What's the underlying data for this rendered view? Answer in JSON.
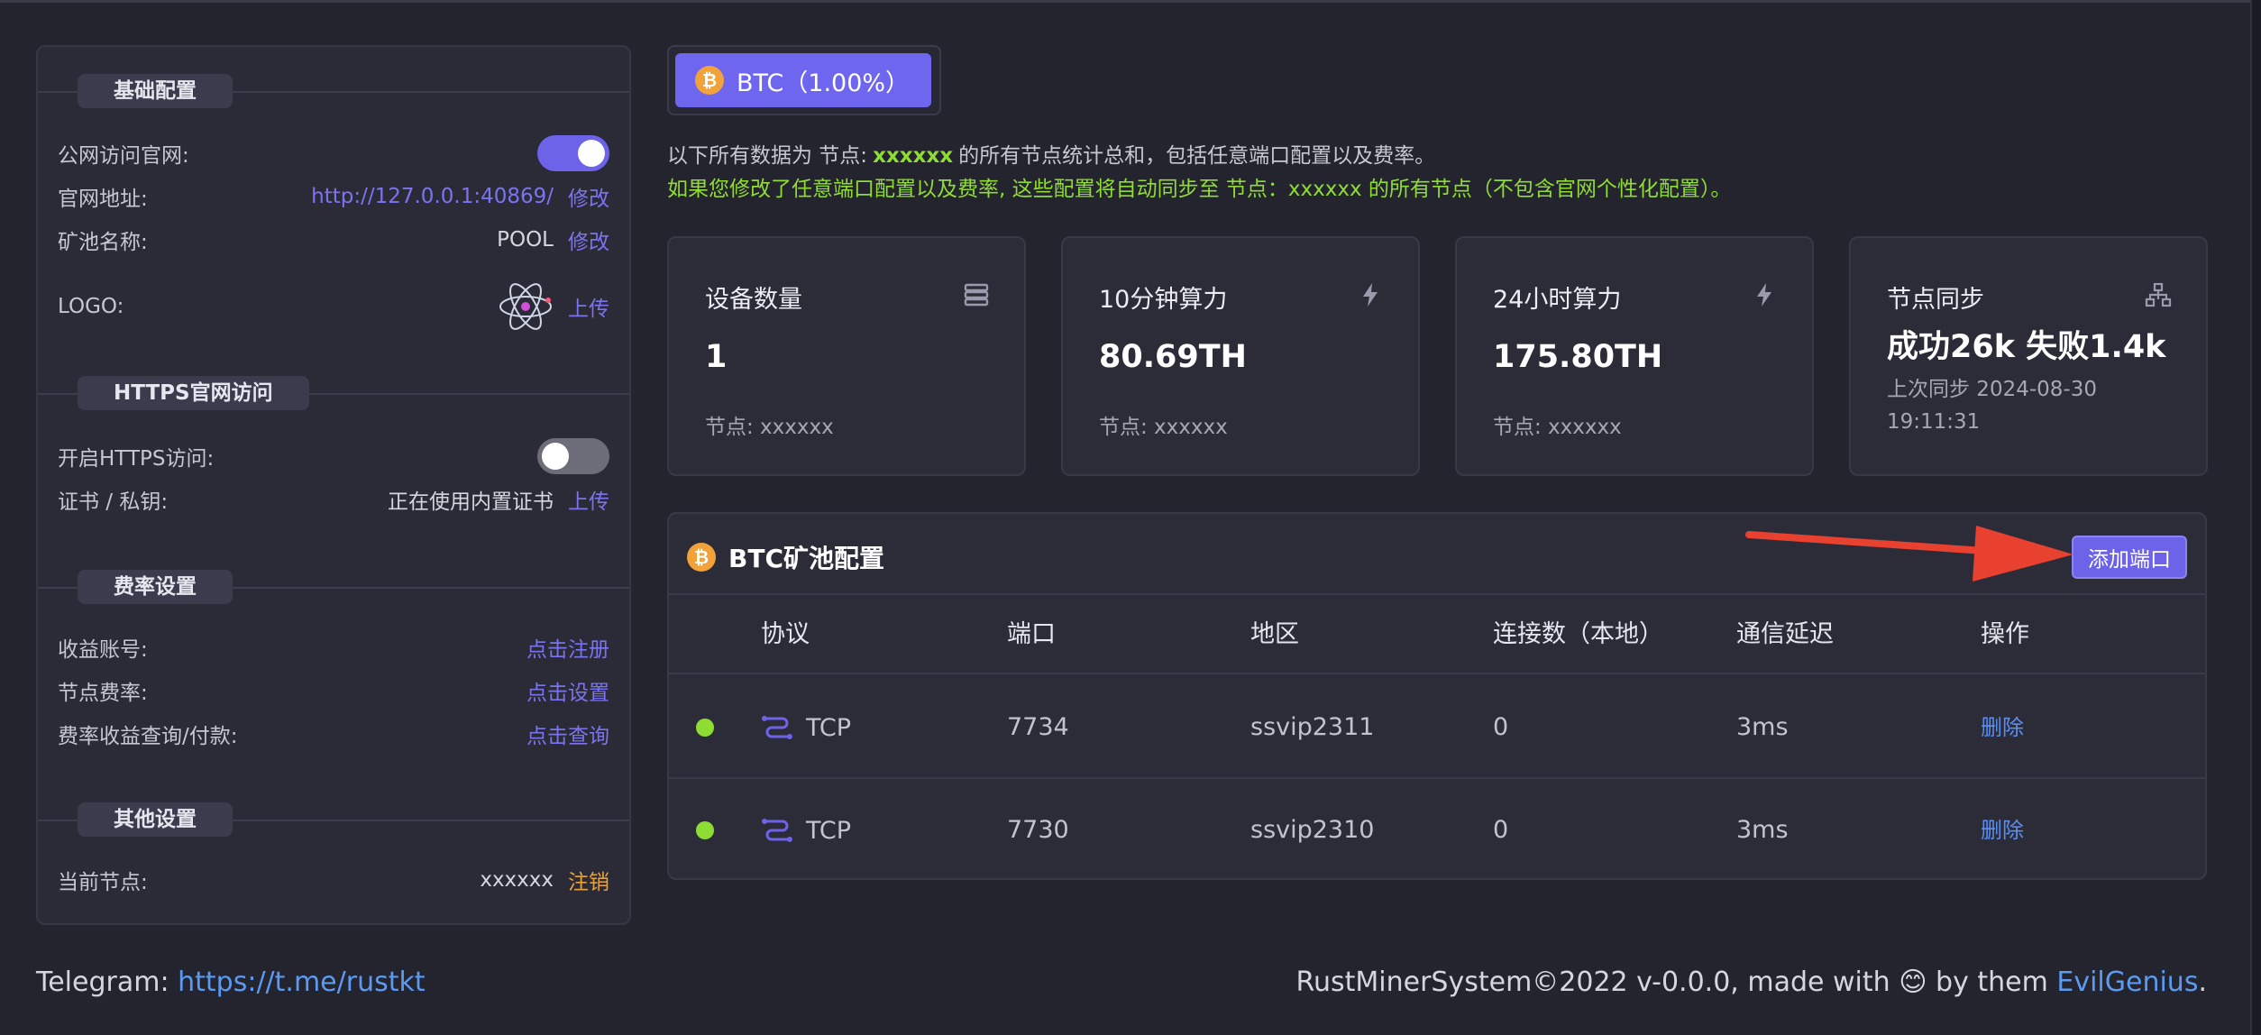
{
  "left_panel": {
    "basic": {
      "title": "基础配置",
      "public_access_label": "公网访问官网:",
      "public_access_on": true,
      "site_url_label": "官网地址:",
      "site_url": "http://127.0.0.1:40869/",
      "site_url_action": "修改",
      "pool_name_label": "矿池名称:",
      "pool_name": "POOL",
      "pool_name_action": "修改",
      "logo_label": "LOGO:",
      "logo_icon": "atom-icon",
      "logo_action": "上传"
    },
    "https": {
      "title": "HTTPS官网访问",
      "enable_label": "开启HTTPS访问:",
      "enable_on": false,
      "cert_label": "证书 / 私钥:",
      "cert_value": "正在使用内置证书",
      "cert_action": "上传"
    },
    "fee": {
      "title": "费率设置",
      "account_label": "收益账号:",
      "account_action": "点击注册",
      "rate_label": "节点费率:",
      "rate_action": "点击设置",
      "query_label": "费率收益查询/付款:",
      "query_action": "点击查询"
    },
    "other": {
      "title": "其他设置",
      "node_label": "当前节点:",
      "node_value": "xxxxxx",
      "node_action": "注销"
    }
  },
  "coin": {
    "label": "BTC（1.00%）",
    "icon_letter": "₿"
  },
  "notes": {
    "line1_prefix": "以下所有数据为 节点:",
    "line1_node": "xxxxxx",
    "line1_suffix": "的所有节点统计总和，包括任意端口配置以及费率。",
    "line2": "如果您修改了任意端口配置以及费率, 这些配置将自动同步至 节点：xxxxxx 的所有节点（不包含官网个性化配置）。"
  },
  "cards": [
    {
      "title": "设备数量",
      "value": "1",
      "sub": "节点: xxxxxx",
      "icon": "server-icon"
    },
    {
      "title": "10分钟算力",
      "value": "80.69TH",
      "sub": "节点: xxxxxx",
      "icon": "bolt-icon"
    },
    {
      "title": "24小时算力",
      "value": "175.80TH",
      "sub": "节点: xxxxxx",
      "icon": "bolt-icon"
    },
    {
      "title": "节点同步",
      "value": "成功26k 失败1.4k",
      "sub": "上次同步 2024-08-30 19:11:31",
      "icon": "network-icon"
    }
  ],
  "pool": {
    "title": "BTC矿池配置",
    "add_button": "添加端口",
    "columns": [
      "协议",
      "端口",
      "地区",
      "连接数（本地）",
      "通信延迟",
      "操作"
    ],
    "rows": [
      {
        "protocol": "TCP",
        "port": "7734",
        "region": "ssvip2311",
        "connections": "0",
        "latency": "3ms",
        "action": "删除"
      },
      {
        "protocol": "TCP",
        "port": "7730",
        "region": "ssvip2310",
        "connections": "0",
        "latency": "3ms",
        "action": "删除"
      }
    ]
  },
  "footer": {
    "telegram_label": "Telegram:",
    "telegram_link": "https://t.me/rustkt",
    "copyright_prefix": "RustMinerSystem©2022 v-0.0.0, made with",
    "emoji": "😊",
    "by_text": "by them",
    "author_link": "EvilGenius",
    "end": "."
  },
  "colors": {
    "accent": "#6c63e8",
    "green": "#8fdc35",
    "btc_orange": "#f2a23a",
    "link_blue": "#5b9af0",
    "arrow_red": "#e8412f"
  }
}
